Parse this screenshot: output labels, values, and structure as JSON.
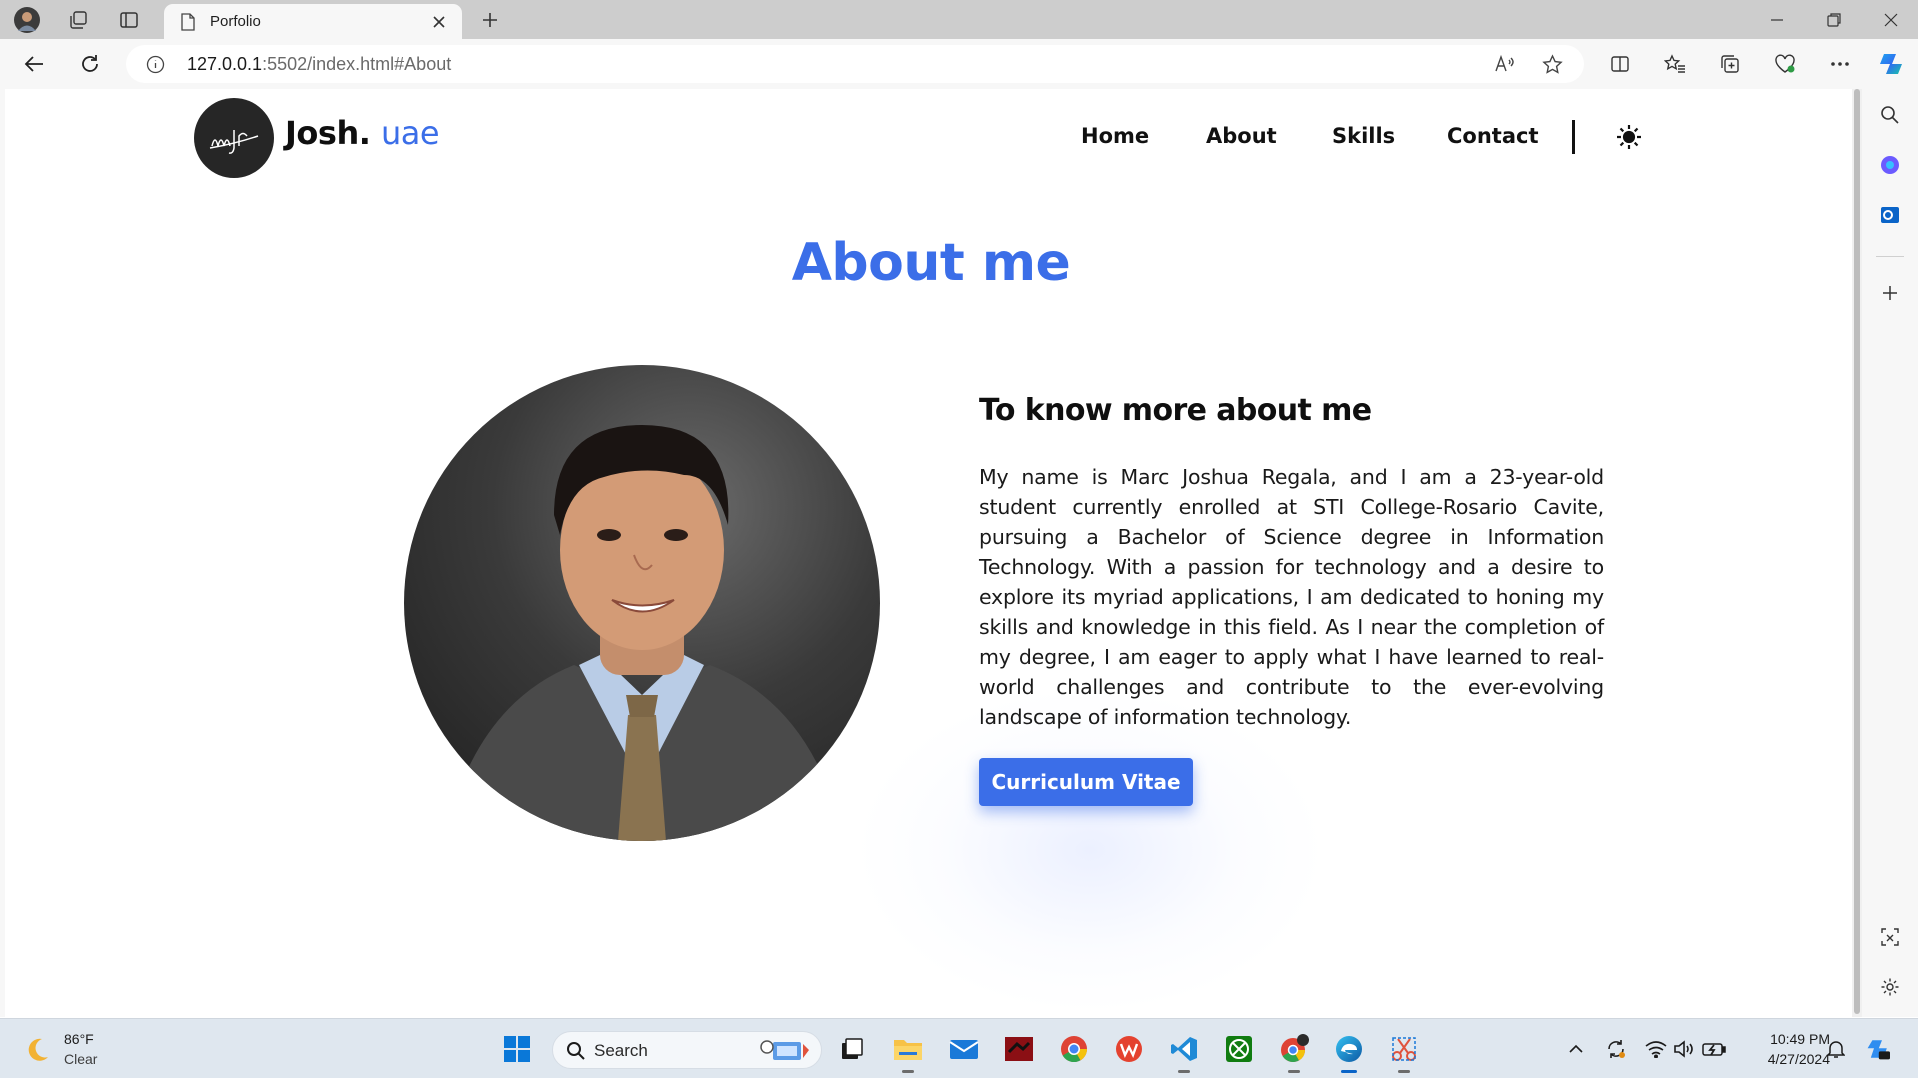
{
  "browser": {
    "tab_title": "Porfolio",
    "url_host": "127.0.0.1",
    "url_path": ":5502/index.html#About",
    "icons": [
      "profile-avatar",
      "workspaces-icon",
      "tab-actions-icon",
      "page-icon",
      "close-icon",
      "new-tab-icon",
      "minimize-icon",
      "restore-icon",
      "window-close-icon",
      "back-icon",
      "refresh-icon",
      "site-info-icon",
      "read-aloud-icon",
      "favorite-star-icon",
      "split-screen-icon",
      "favorites-icon",
      "collections-icon",
      "browser-essentials-icon",
      "more-icon",
      "copilot-icon"
    ]
  },
  "sidebar": {
    "icons": [
      "search-icon",
      "copilot-app-icon",
      "outlook-icon",
      "add-icon",
      "screenshot-icon",
      "settings-icon"
    ]
  },
  "site": {
    "brand_name": "Josh.",
    "brand_accent": "uae",
    "logo_text": "mjr",
    "nav": [
      "Home",
      "About",
      "Skills",
      "Contact"
    ],
    "theme_toggle_icon": "sun-icon",
    "section_title": "About me",
    "subtitle": "To know more about me",
    "bio": "My name is Marc Joshua Regala, and I am a 23-year-old student currently enrolled at STI College-Rosario Cavite, pursuing a Bachelor of Science degree in Information Technology. With a passion for technology and a desire to explore its myriad applications, I am dedicated to honing my skills and knowledge in this field. As I near the completion of my degree, I am eager to apply what I have learned to real-world challenges and contribute to the ever-evolving landscape of information technology.",
    "cv_button": "Curriculum Vitae",
    "accent_color": "#3b6ee8"
  },
  "taskbar": {
    "weather_temp": "86°F",
    "weather_condition": "Clear",
    "search_label": "Search",
    "time": "10:49 PM",
    "date": "4/27/2024",
    "apps": [
      "start-icon",
      "task-view-icon",
      "file-explorer-icon",
      "mail-icon",
      "app-red-icon",
      "chrome-icon",
      "wps-icon",
      "vscode-icon",
      "xbox-icon",
      "chrome-profile-icon",
      "edge-icon",
      "snipping-icon"
    ],
    "tray": [
      "chevron-up-icon",
      "sync-icon",
      "wifi-icon",
      "volume-icon",
      "battery-icon",
      "notification-icon",
      "copilot-tray-icon"
    ]
  }
}
